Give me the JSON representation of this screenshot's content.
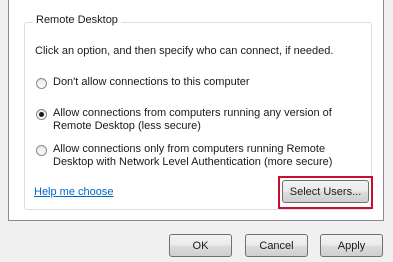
{
  "group": {
    "legend": "Remote Desktop",
    "instruction": "Click an option, and then specify who can connect, if needed."
  },
  "options": [
    {
      "line1": "Don't allow connections to this computer",
      "line2": "",
      "selected": false
    },
    {
      "line1": "Allow connections from computers running any version of",
      "line2": "Remote Desktop (less secure)",
      "selected": true
    },
    {
      "line1": "Allow connections only from computers running Remote",
      "line2": "Desktop with Network Level Authentication (more secure)",
      "selected": false
    }
  ],
  "help_link": "Help me choose",
  "select_users_label": "Select Users...",
  "footer": {
    "ok_label": "OK",
    "cancel_label": "Cancel",
    "apply_label": "Apply"
  }
}
